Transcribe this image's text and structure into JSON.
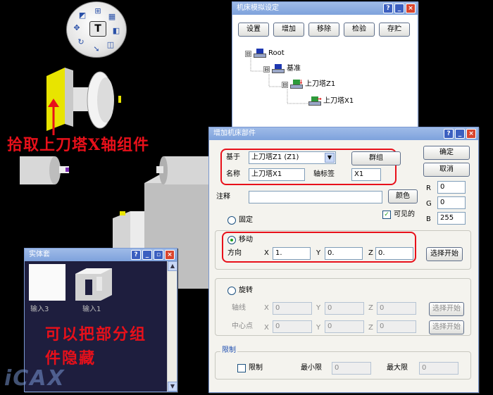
{
  "radial_menu": {
    "center_label": "T",
    "icons": [
      "table-icon",
      "grid-icon",
      "move-icon",
      "rotate-icon",
      "cube-icon",
      "cylinder-icon",
      "arrow-icon",
      "block-icon"
    ]
  },
  "annotations": {
    "pick_component": "拾取上刀塔X轴组件",
    "hide_components": "可以把部分组件隐藏"
  },
  "machine_config_window": {
    "title": "机床模拟设定",
    "buttons": [
      "设置",
      "增加",
      "移除",
      "检验",
      "存贮"
    ],
    "tree": [
      {
        "label": "Root",
        "level": 0,
        "expander": "⊟"
      },
      {
        "label": "基准",
        "level": 1,
        "expander": "⊟"
      },
      {
        "label": "上刀塔Z1",
        "level": 2,
        "expander": "⊟"
      },
      {
        "label": "上刀塔X1",
        "level": 3,
        "expander": ""
      }
    ]
  },
  "add_component_window": {
    "title": "增加机床部件",
    "base_label": "基于",
    "base_value": "上刀塔Z1 (Z1)",
    "group_button": "群组",
    "name_label": "名称",
    "name_value": "上刀塔X1",
    "axis_label": "轴标签",
    "axis_value": "X1",
    "note_label": "注释",
    "note_value": "",
    "color_button": "颜色",
    "ok_button": "确定",
    "cancel_button": "取消",
    "r_label": "R",
    "r_value": "0",
    "g_label": "G",
    "g_value": "0",
    "b_label": "B",
    "b_value": "255",
    "fixed_label": "固定",
    "visible_label": "可见的",
    "move_label": "移动",
    "direction_label": "方向",
    "dir_x_label": "X",
    "dir_x_value": "1.",
    "dir_y_label": "Y",
    "dir_y_value": "0.",
    "dir_z_label": "Z",
    "dir_z_value": "0.",
    "select_start_button": "选择开始",
    "rotate_label": "旋转",
    "axis_line_label": "轴线",
    "center_label": "中心点",
    "rot_x_value": "0",
    "rot_y_value": "0",
    "rot_z_value": "0",
    "ctr_x_value": "0",
    "ctr_y_value": "0",
    "ctr_z_value": "0",
    "limit_group_label": "限制",
    "limit_check_label": "限制",
    "min_label": "最小限",
    "min_value": "0",
    "max_label": "最大限",
    "max_value": "0",
    "coord_x": "X",
    "coord_y": "Y",
    "coord_z": "Z"
  },
  "entity_window": {
    "title": "实体套",
    "items": [
      "输入3",
      "输入1"
    ]
  },
  "watermark": "iCAX"
}
